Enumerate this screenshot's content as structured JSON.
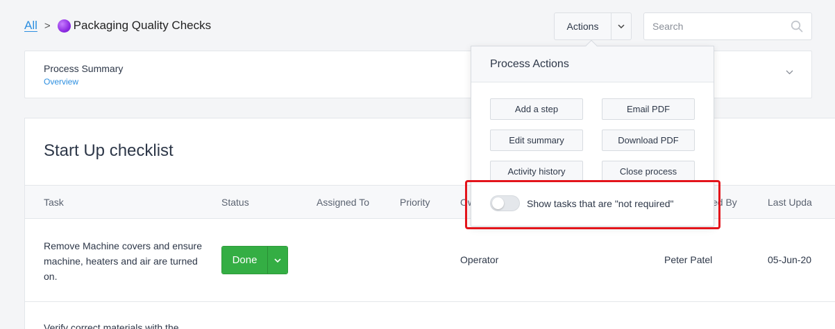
{
  "breadcrumb": {
    "all_label": "All",
    "separator": ">",
    "title": "Packaging Quality Checks"
  },
  "header": {
    "actions_label": "Actions",
    "search_placeholder": "Search"
  },
  "summary": {
    "title": "Process Summary",
    "subtitle": "Overview"
  },
  "checklist": {
    "title": "Start Up checklist",
    "columns": [
      "Task",
      "Status",
      "Assigned To",
      "Priority",
      "Ow",
      "ed By",
      "Last Upda"
    ],
    "rows": [
      {
        "task": "Remove Machine covers and ensure machine, heaters and air are turned on.",
        "status": "Done",
        "owner": "Operator",
        "completed_by": "Peter Patel",
        "last_updated": "05-Jun-20"
      },
      {
        "task": "Verify correct materials with the"
      }
    ]
  },
  "dropdown": {
    "title": "Process Actions",
    "buttons": [
      "Add a step",
      "Email PDF",
      "Edit summary",
      "Download PDF",
      "Activity history",
      "Close process"
    ],
    "toggle_label": "Show tasks that are \"not required\"",
    "toggle_on": false
  },
  "colors": {
    "accent": "#2b8ee0",
    "done_green": "#34ae44",
    "highlight_red": "#e3141b"
  }
}
